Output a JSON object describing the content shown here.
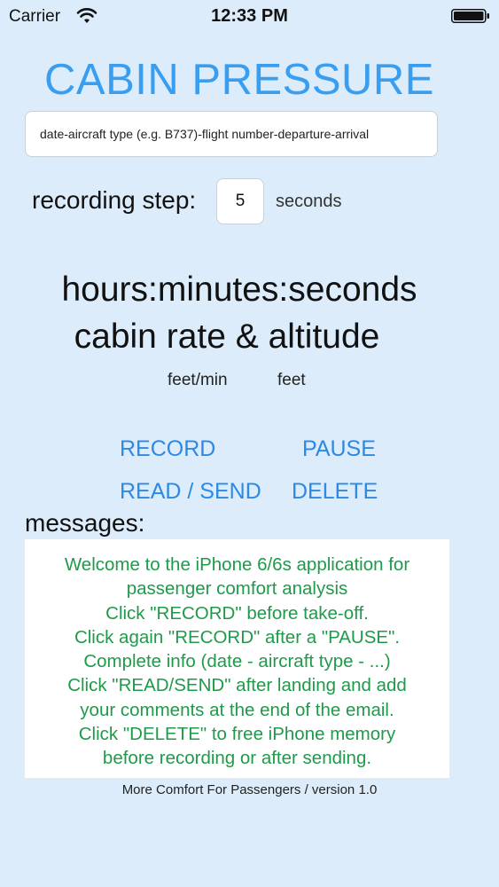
{
  "status_bar": {
    "carrier": "Carrier",
    "time": "12:33 PM",
    "icons": [
      "wifi-icon",
      "battery-icon"
    ]
  },
  "app": {
    "title": "CABIN PRESSURE",
    "title_color": "#3a9ef0"
  },
  "flight_info": {
    "placeholder": "date-aircraft type (e.g. B737)-flight number-departure-arrival",
    "value": ""
  },
  "recording_step": {
    "label": "recording step:",
    "value": "5",
    "unit": "seconds"
  },
  "display": {
    "time_format": "hours:minutes:seconds",
    "rate_altitude": "cabin rate & altitude",
    "rate_unit": "feet/min",
    "altitude_unit": "feet"
  },
  "buttons": {
    "record": "RECORD",
    "pause": "PAUSE",
    "read_send": "READ / SEND",
    "delete": "DELETE",
    "color": "#2b8ae6"
  },
  "messages": {
    "label": "messages:",
    "text_color": "#1f9a4a",
    "lines": [
      "Welcome to the iPhone 6/6s application for",
      "passenger comfort analysis",
      "Click \"RECORD\" before take-off.",
      "Click again \"RECORD\" after a \"PAUSE\".",
      "Complete info (date - aircraft type - ...)",
      "Click \"READ/SEND\" after landing and add",
      "your comments at the end of the email.",
      "Click  \"DELETE\" to free iPhone memory",
      "before recording or after sending."
    ]
  },
  "footer": "More Comfort For Passengers / version 1.0"
}
